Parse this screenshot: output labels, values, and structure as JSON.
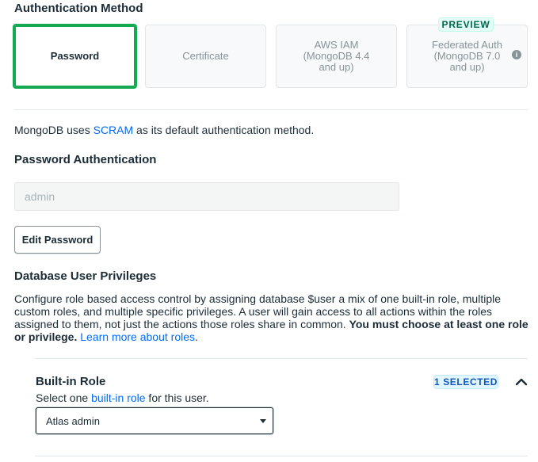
{
  "auth": {
    "heading": "Authentication Method",
    "methods": [
      {
        "line1": "Password",
        "line2": "",
        "line3": ""
      },
      {
        "line1": "Certificate",
        "line2": "",
        "line3": ""
      },
      {
        "line1": "AWS IAM",
        "line2": "(MongoDB 4.4",
        "line3": "and up)"
      },
      {
        "line1": "Federated Auth",
        "line2": "(MongoDB 7.0",
        "line3": "and up)"
      }
    ],
    "selected": "Password",
    "preview_badge": "PREVIEW",
    "intro_before": "MongoDB uses ",
    "intro_link": "SCRAM",
    "intro_after": " as its default authentication method."
  },
  "password": {
    "heading": "Password Authentication",
    "username_value": "admin",
    "edit_button": "Edit Password"
  },
  "privileges": {
    "heading": "Database User Privileges",
    "description": "Configure role based access control by assigning database $user a mix of one built-in role, multiple custom roles, and multiple specific privileges. A user will gain access to all actions within the roles assigned to them, not just the actions those roles share in common. ",
    "description_bold": "You must choose at least one role or privilege.",
    "learn_more_link": "Learn more about roles",
    "learn_more_suffix": "."
  },
  "builtin_role": {
    "heading": "Built-in Role",
    "selected_badge": "1 SELECTED",
    "hint_before": "Select one ",
    "hint_link": "built-in role",
    "hint_after": " for this user.",
    "selected_value": "Atlas admin"
  },
  "colors": {
    "accent_green": "#13aa52",
    "link_blue": "#016bf8"
  },
  "icons": {
    "info": "info-icon",
    "chevron": "chevron-up-icon",
    "caret": "caret-down-icon"
  }
}
